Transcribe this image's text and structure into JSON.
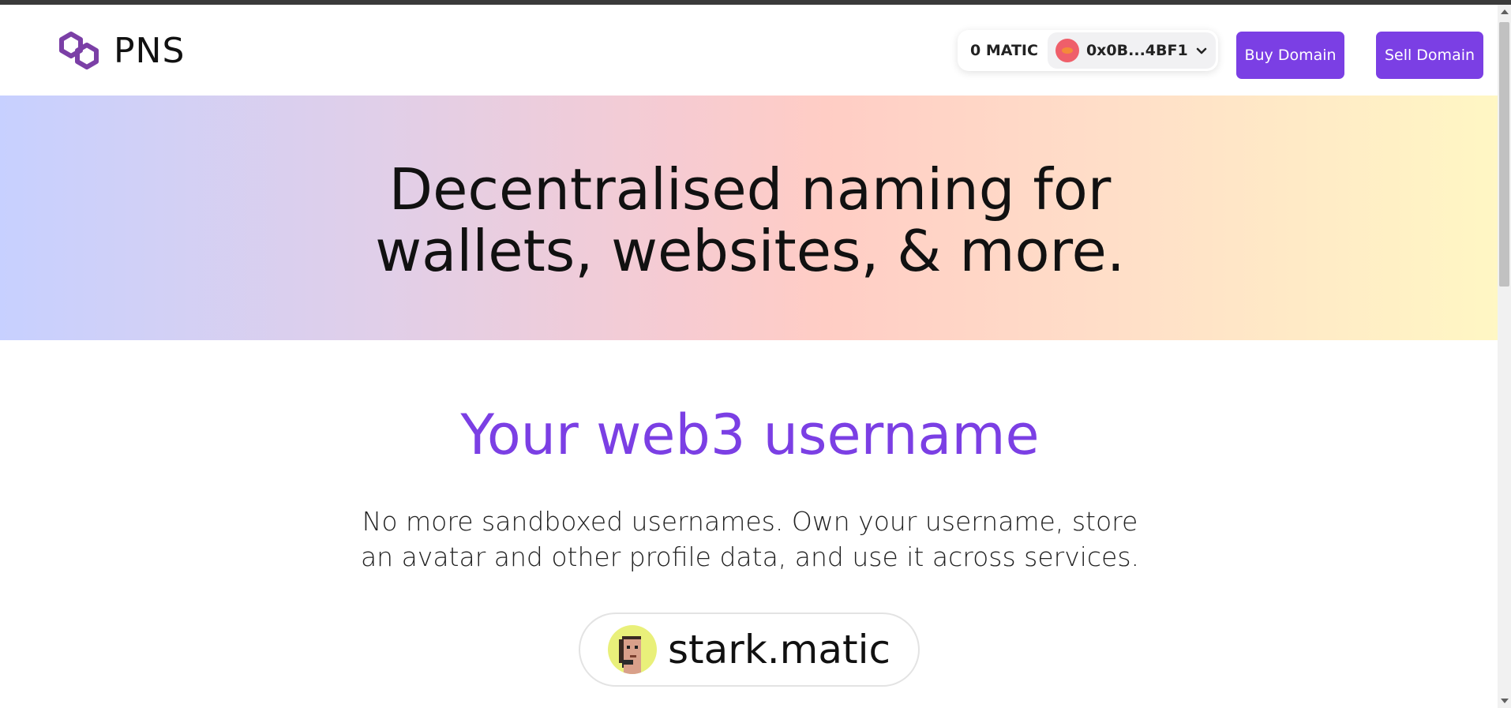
{
  "header": {
    "logo_text": "PNS",
    "wallet": {
      "balance": "0 MATIC",
      "account": "0x0B...4BF1"
    },
    "buy_label": "Buy Domain",
    "sell_label": "Sell Domain"
  },
  "hero": {
    "title_line1": "Decentralised naming for",
    "title_line2": "wallets, websites, & more."
  },
  "section": {
    "title": "Your web3 username",
    "desc_line1": "No more sandboxed usernames. Own your username, store",
    "desc_line2": "an avatar and other profile data, and use it across services.",
    "example_name": "stark.matic"
  },
  "colors": {
    "accent": "#7b3fe4",
    "logo": "#7b3fa6"
  },
  "icons": [
    "polygon-logo-icon",
    "account-avatar-icon",
    "chevron-down-icon",
    "pixel-avatar-icon"
  ]
}
